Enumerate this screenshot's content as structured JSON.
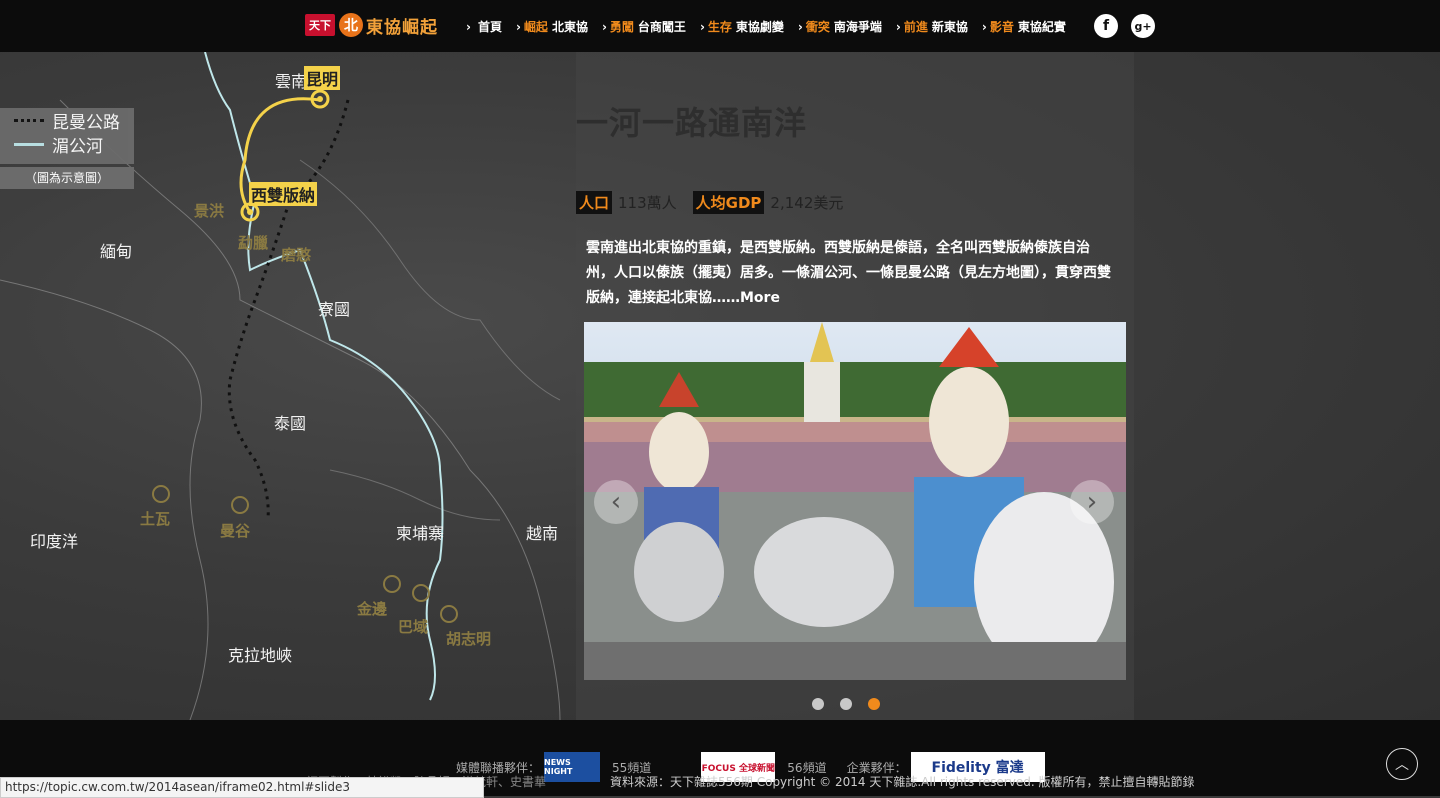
{
  "nav": {
    "logo_cw": "天下",
    "logo_north": "北",
    "logo_title": "東協崛起",
    "items": [
      {
        "hl": "",
        "label": "首頁"
      },
      {
        "hl": "崛起",
        "label": "北東協"
      },
      {
        "hl": "勇闖",
        "label": "台商闖王"
      },
      {
        "hl": "生存",
        "label": "東協劇變"
      },
      {
        "hl": "衝突",
        "label": "南海爭端"
      },
      {
        "hl": "前進",
        "label": "新東協"
      },
      {
        "hl": "影音",
        "label": "東協紀實"
      }
    ],
    "facebook": "f",
    "googleplus": "g+"
  },
  "map": {
    "legend": {
      "road": "昆曼公路",
      "river": "湄公河"
    },
    "note": "（圖為示意圖）",
    "labels": {
      "yunnan": "雲南",
      "kunming": "昆明",
      "xsbn": "西雙版納",
      "jinghong": "景洪",
      "burma": "緬甸",
      "laos": "寮國",
      "thailand": "泰國",
      "cambodia": "柬埔寨",
      "vietnam": "越南",
      "indian_ocean": "印度洋",
      "kra": "克拉地峽",
      "tuwa": "土瓦",
      "bangkok": "曼谷",
      "jinbian": "金邊",
      "bavet": "巴域",
      "hcmc": "胡志明",
      "mohan": "磨憨",
      "mengla": "勐臘"
    }
  },
  "article": {
    "headline": "一河一路通南洋",
    "stats": [
      {
        "tag": "人口",
        "value": "113萬人"
      },
      {
        "tag": "人均GDP",
        "value": "2,142美元"
      }
    ],
    "desc": "雲南進出北東協的重鎮，是西雙版納。西雙版納是傣語，全名叫西雙版納傣族自治州，人口以傣族（擺夷）居多。一條湄公河、一條昆曼公路（見左方地圖），貫穿西雙版納，連接起北東協……",
    "more": "More",
    "slider": {
      "prev": "‹",
      "next": "›",
      "dots": 3,
      "active": 3
    }
  },
  "footer": {
    "media_partner": "媒體聯播夥伴：",
    "newsnight": "NEWS NIGHT",
    "channel55": "55頻道",
    "focus": "FOCUS 全球新聞",
    "channel56": "56頻道",
    "corp_partner": "企業夥伴：",
    "fidelity": "Fidelity 富達",
    "credits": "網頁製作：林裕凱、陳品妤、洪梵軒、史書華",
    "copyright": "資料來源：天下雜誌556期  Copyright © 2014 天下雜誌.All rights reserved. 版權所有，禁止擅自轉貼節錄"
  },
  "status_url": "https://topic.cw.com.tw/2014asean/iframe02.html#slide3"
}
